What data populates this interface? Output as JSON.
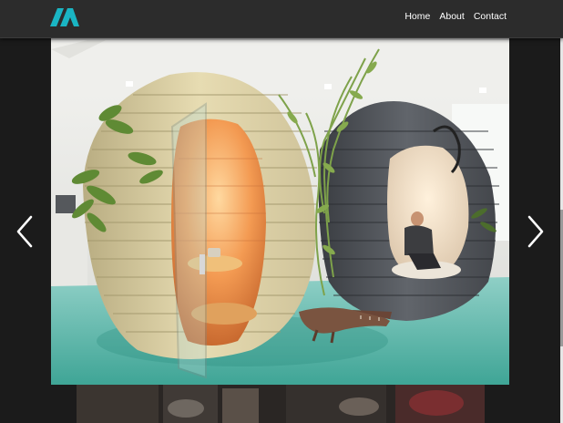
{
  "nav": {
    "links": [
      {
        "label": "Home"
      },
      {
        "label": "About"
      },
      {
        "label": "Contact"
      }
    ]
  },
  "slider": {
    "accent": "#1ab5c3",
    "prev_icon": "chevron-left-icon",
    "next_icon": "chevron-right-icon"
  },
  "colors": {
    "navbar": "#2c2c2c",
    "page": "#1b1b1b",
    "text": "#ffffff"
  }
}
